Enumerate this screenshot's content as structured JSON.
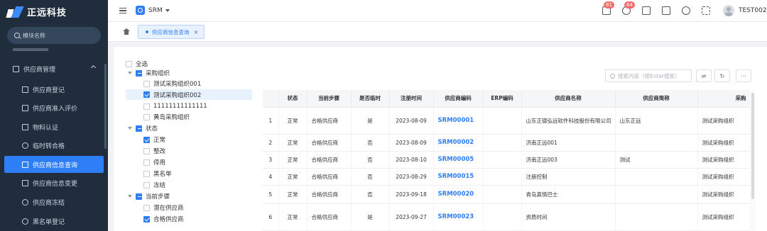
{
  "sidebar": {
    "brand": "正远科技",
    "search_placeholder": "模块名称",
    "group_label": "供应商管理",
    "items": [
      {
        "label": "供应商登记",
        "icon": "document-icon"
      },
      {
        "label": "供应商准入评价",
        "icon": "folder-icon"
      },
      {
        "label": "物料认证",
        "icon": "file-icon"
      },
      {
        "label": "临时转合格",
        "icon": "gear-icon"
      },
      {
        "label": "供应商信息查询",
        "icon": "document-icon",
        "active": true
      },
      {
        "label": "供应商信息变更",
        "icon": "edit-icon"
      },
      {
        "label": "供应商冻结",
        "icon": "cloud-icon"
      },
      {
        "label": "黑名单登记",
        "icon": "eye-icon"
      }
    ]
  },
  "topbar": {
    "app_name": "SRM",
    "badge_messages": "81",
    "badge_notifications": "64",
    "username": "TEST002"
  },
  "tabs": [
    {
      "label": "供应商信息查询",
      "active": true
    }
  ],
  "tree": {
    "select_all": "全选",
    "groups": [
      {
        "label": "采购组织",
        "children": [
          {
            "label": "测试采购组织001",
            "checked": false
          },
          {
            "label": "测试采购组织002",
            "checked": true
          },
          {
            "label": "11111111111111",
            "checked": false
          },
          {
            "label": "黄岛采购组织",
            "checked": false
          }
        ]
      },
      {
        "label": "状态",
        "children": [
          {
            "label": "正常",
            "checked": true
          },
          {
            "label": "整改",
            "checked": false
          },
          {
            "label": "停用",
            "checked": false
          },
          {
            "label": "黑名单",
            "checked": false
          },
          {
            "label": "冻结",
            "checked": false
          }
        ]
      },
      {
        "label": "当前步骤",
        "children": [
          {
            "label": "潜在供应商",
            "checked": false
          },
          {
            "label": "合格供应商",
            "checked": true
          }
        ]
      }
    ]
  },
  "grid": {
    "search_placeholder": "搜索内容（按Enter搜索）",
    "columns": [
      "",
      "状态",
      "当前步骤",
      "是否临时",
      "注册时间",
      "供应商编码",
      "ERP编码",
      "供应商名称",
      "供应商简称",
      "采购"
    ],
    "rows": [
      [
        "1",
        "正常",
        "合格供应商",
        "是",
        "2023-08-09",
        "SRM00001",
        "",
        "山东正德弘远软件科技股份有限公司",
        "山东正远",
        "测试采购组织"
      ],
      [
        "2",
        "正常",
        "合格供应商",
        "否",
        "2023-08-09",
        "SRM00002",
        "",
        "济南正远001",
        "",
        "测试采购组织"
      ],
      [
        "3",
        "正常",
        "合格供应商",
        "否",
        "2023-08-10",
        "SRM00005",
        "",
        "济南正远003",
        "测试",
        "测试采购组织"
      ],
      [
        "4",
        "正常",
        "合格供应商",
        "否",
        "2023-08-29",
        "SRM00015",
        "",
        "注册控制",
        "",
        "测试采购组织"
      ],
      [
        "5",
        "正常",
        "合格供应商",
        "否",
        "2023-09-18",
        "SRM00020",
        "",
        "青岛真情巴士",
        "",
        "测试采购组织"
      ],
      [
        "6",
        "正常",
        "合格供应商",
        "是",
        "2023-09-27",
        "SRM00023",
        "",
        "资质时间",
        "",
        "测试采购组织"
      ]
    ]
  }
}
